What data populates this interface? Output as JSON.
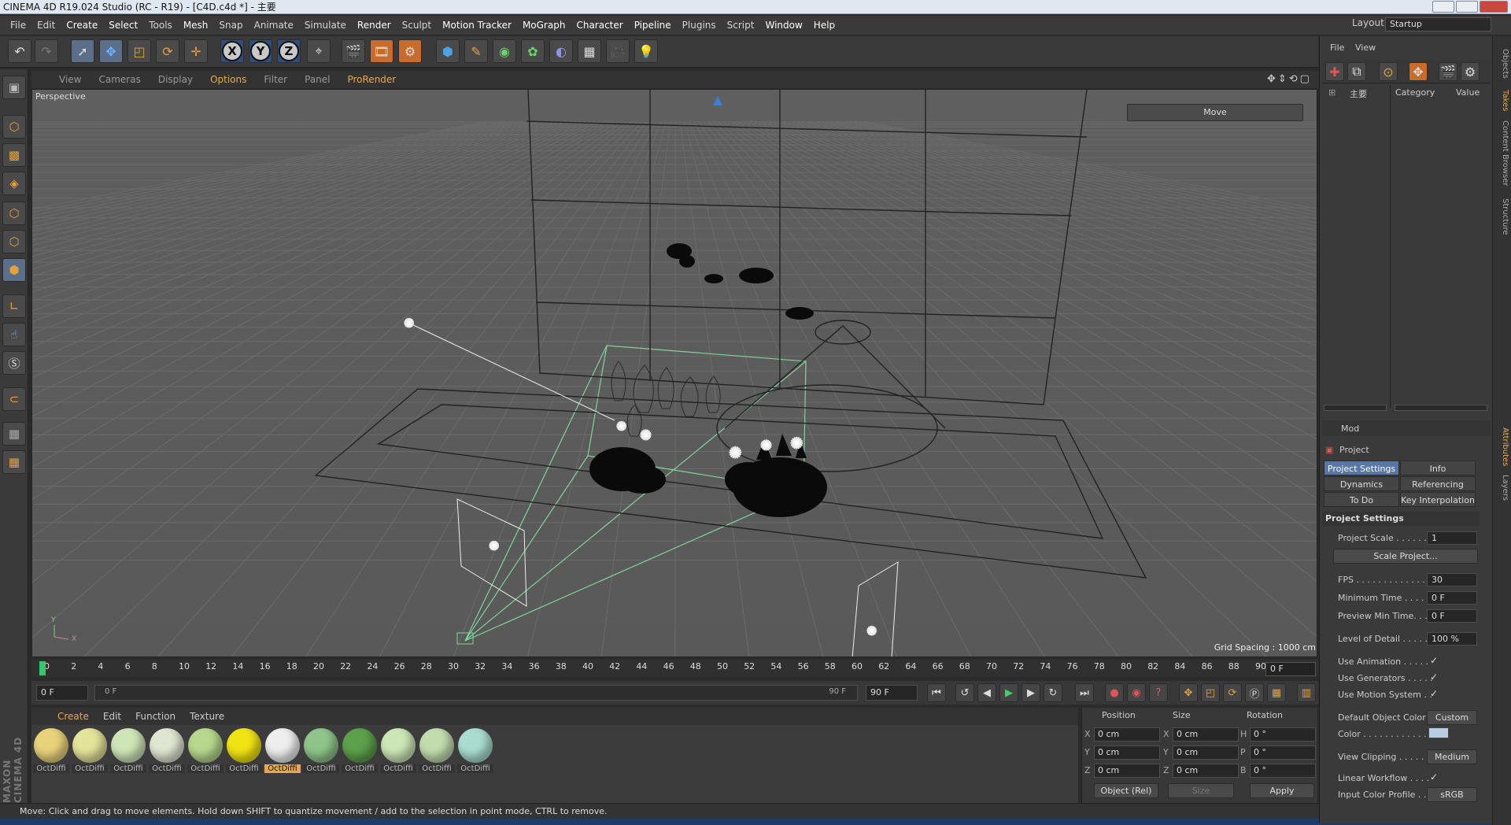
{
  "window": {
    "title": "CINEMA 4D R19.024 Studio (RC - R19) - [C4D.c4d *] - 主要"
  },
  "menubar": {
    "items": [
      "File",
      "Edit",
      "Create",
      "Select",
      "Tools",
      "Mesh",
      "Snap",
      "Animate",
      "Simulate",
      "Render",
      "Sculpt",
      "Motion Tracker",
      "MoGraph",
      "Character",
      "Pipeline",
      "Plugins",
      "Script",
      "Window",
      "Help"
    ]
  },
  "layout": {
    "label": "Layout:",
    "value": "Startup"
  },
  "toolbar": {
    "axis_x": "X",
    "axis_y": "Y",
    "axis_z": "Z"
  },
  "viewport": {
    "menu": [
      "View",
      "Cameras",
      "Display",
      "Options",
      "Filter",
      "Panel",
      "ProRender"
    ],
    "label": "Perspective",
    "hud": "Move",
    "grid_spacing": "Grid Spacing : 1000 cm"
  },
  "timeline": {
    "ticks": [
      "0",
      "2",
      "4",
      "6",
      "8",
      "10",
      "12",
      "14",
      "16",
      "18",
      "20",
      "22",
      "24",
      "26",
      "28",
      "30",
      "32",
      "34",
      "36",
      "38",
      "40",
      "42",
      "44",
      "46",
      "48",
      "50",
      "52",
      "54",
      "56",
      "58",
      "60",
      "62",
      "64",
      "66",
      "68",
      "70",
      "72",
      "74",
      "76",
      "78",
      "80",
      "82",
      "84",
      "86",
      "88",
      "90"
    ],
    "current_frame": "0 F",
    "start_field": "0 F",
    "range_start": "0 F",
    "range_end": "90 F",
    "end_field": "90 F"
  },
  "materials": {
    "menu": [
      "Create",
      "Edit",
      "Function",
      "Texture"
    ],
    "items": [
      {
        "label": "OctDiffi",
        "color": "#e8d27a",
        "selected": false
      },
      {
        "label": "OctDiffi",
        "color": "#e3e39a",
        "selected": false
      },
      {
        "label": "OctDiffi",
        "color": "#cfe5b7",
        "selected": false
      },
      {
        "label": "OctDiffi",
        "color": "#dfe6d2",
        "selected": false
      },
      {
        "label": "OctDiffi",
        "color": "#b7d88d",
        "selected": false
      },
      {
        "label": "OctDiffi",
        "color": "#f0e414",
        "selected": false
      },
      {
        "label": "OctDiffi",
        "color": "#eeeeee",
        "selected": true
      },
      {
        "label": "OctDiffi",
        "color": "#8ec58a",
        "selected": false
      },
      {
        "label": "OctDiffi",
        "color": "#5da04b",
        "selected": false
      },
      {
        "label": "OctDiffi",
        "color": "#cde6b6",
        "selected": false
      },
      {
        "label": "OctDiffi",
        "color": "#c2dcae",
        "selected": false
      },
      {
        "label": "OctDiffi",
        "color": "#a9ddd0",
        "selected": false
      }
    ]
  },
  "coordinates": {
    "headers": [
      "Position",
      "Size",
      "Rotation"
    ],
    "rows": [
      {
        "axis": "X",
        "pos": "0 cm",
        "size_axis": "X",
        "size": "0 cm",
        "rot_axis": "H",
        "rot": "0 °"
      },
      {
        "axis": "Y",
        "pos": "0 cm",
        "size_axis": "Y",
        "size": "0 cm",
        "rot_axis": "P",
        "rot": "0 °"
      },
      {
        "axis": "Z",
        "pos": "0 cm",
        "size_axis": "Z",
        "size": "0 cm",
        "rot_axis": "B",
        "rot": "0 °"
      }
    ],
    "mode": "Object (Rel)",
    "size_mode": "Size",
    "apply": "Apply"
  },
  "status": "Move: Click and drag to move elements. Hold down SHIFT to quantize movement / add to the selection in point mode, CTRL to remove.",
  "maxon": "MAXON CINEMA 4D",
  "objects": {
    "menu": [
      "File",
      "View"
    ],
    "item": "主要",
    "col_category": "Category",
    "col_value": "Value"
  },
  "attributes": {
    "mode": "Mod",
    "title": "Project",
    "tabs": [
      "Project Settings",
      "Info",
      "Dynamics",
      "Referencing",
      "To Do",
      "Key Interpolation"
    ],
    "section": "Project Settings",
    "rows": {
      "scale": {
        "label": "Project Scale . . . . . . .",
        "value": "1"
      },
      "scale_btn": "Scale Project...",
      "fps": {
        "label": "FPS . . . . . . . . . . . . . .",
        "value": "30"
      },
      "min_time": {
        "label": "Minimum Time . . . . .",
        "value": "0 F"
      },
      "prev_min": {
        "label": "Preview Min Time. . .",
        "value": "0 F"
      },
      "lod": {
        "label": "Level of Detail . . . . .",
        "value": "100 %"
      },
      "use_anim": {
        "label": "Use Animation . . . . .",
        "value": "✓"
      },
      "use_gen": {
        "label": "Use Generators . . . . .",
        "value": "✓"
      },
      "use_motion": {
        "label": "Use Motion System . .",
        "value": "✓"
      },
      "def_color": {
        "label": "Default Object Color",
        "value": "Custom"
      },
      "color": {
        "label": "Color . . . . . . . . . . . ."
      },
      "clipping": {
        "label": "View Clipping . . . . . . .",
        "value": "Medium"
      },
      "linear": {
        "label": "Linear Workflow . . . .",
        "value": "✓"
      },
      "profile": {
        "label": "Input Color Profile . . .",
        "value": "sRGB"
      }
    }
  },
  "side_tabs": [
    "Objects",
    "Takes",
    "Content Browser",
    "Structure",
    "Attributes",
    "Layers"
  ]
}
